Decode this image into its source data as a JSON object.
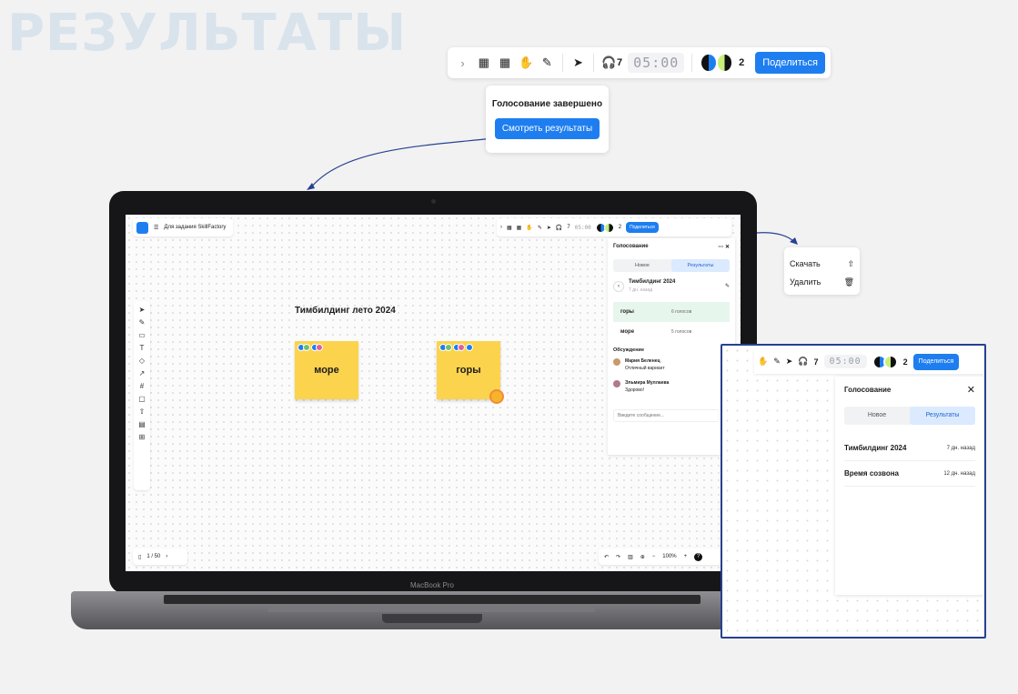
{
  "page_title": "РЕЗУЛЬТАТЫ",
  "toolbar": {
    "headphones_count": "7",
    "timer": "05:00",
    "participants_count": "2",
    "share_label": "Поделиться"
  },
  "vote_popover": {
    "title": "Голосование завершено",
    "button": "Смотреть результаты"
  },
  "laptop": {
    "brand": "MacBook Pro",
    "board_name": "Для задания SkillFactory",
    "headphones_count": "7",
    "timer": "05:00",
    "participants_count": "2",
    "share_label": "Поделиться",
    "board_title": "Тимбилдинг лето 2024",
    "sticky_1": "море",
    "sticky_2": "горы",
    "page_counter": "1 / 50",
    "zoom_level": "100%",
    "help": "?",
    "panel": {
      "title": "Голосование",
      "tab_new": "Новое",
      "tab_results": "Результаты",
      "vote_name": "Тимбилдинг 2024",
      "vote_age": "7 дн. назад",
      "results": [
        {
          "name": "горы",
          "count": "6 голосов"
        },
        {
          "name": "море",
          "count": "5 голосов"
        }
      ],
      "discussion": "Обсуждение",
      "comments": [
        {
          "author": "Мария Беленец",
          "text": "Отличный вариант"
        },
        {
          "author": "Эльмира Муллаева",
          "text": "Здорово!"
        }
      ],
      "message_placeholder": "Введите сообщение..."
    }
  },
  "context_menu": {
    "download": "Скачать",
    "delete": "Удалить"
  },
  "zoom_view": {
    "headphones_count": "7",
    "timer": "05:00",
    "participants_count": "2",
    "share_label": "Поделиться",
    "panel_title": "Голосование",
    "tab_new": "Новое",
    "tab_results": "Результаты",
    "votes": [
      {
        "name": "Тимбилдинг 2024",
        "date": "7 дн. назад"
      },
      {
        "name": "Время созвона",
        "date": "12 дн. назад"
      }
    ]
  },
  "colors": {
    "accent": "#1e7ef0",
    "sticky": "#fcd34d",
    "title_watermark": "#d9e3ec",
    "zoom_border": "#26418f"
  }
}
